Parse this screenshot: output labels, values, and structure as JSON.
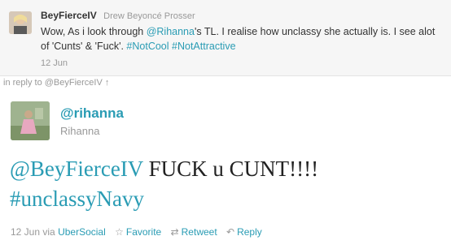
{
  "quoted": {
    "username": "BeyFierceIV",
    "full_name": "Drew Beyoncé Prosser",
    "text_parts": {
      "t1": "Wow, As i look through ",
      "mention": "@Rihanna",
      "t2": "'s TL. I realise how unclassy she actually is. I see alot of 'Cunts' & 'Fuck'. ",
      "hashtag1": "#NotCool",
      "hashtag2": "#NotAttractive"
    },
    "time": "12 Jun"
  },
  "reply": {
    "label": "in reply to @BeyFierceIV",
    "arrow": "↑"
  },
  "tweet": {
    "username": "@rihanna",
    "full_name": "Rihanna",
    "mention": "@BeyFierceIV",
    "text": " FUCK u CUNT!!!!",
    "hashtag": "#unclassyNavy"
  },
  "footer": {
    "time": "12 Jun",
    "via_label": "via",
    "via_app": "UberSocial",
    "favorite_label": "Favorite",
    "retweet_label": "Retweet",
    "reply_label": "Reply",
    "icons": {
      "favorite": "star-icon",
      "retweet": "retweet-icon",
      "reply": "reply-arrow-icon"
    }
  },
  "colors": {
    "link": "#2a9cb4",
    "muted": "#999999",
    "text": "#333333"
  }
}
